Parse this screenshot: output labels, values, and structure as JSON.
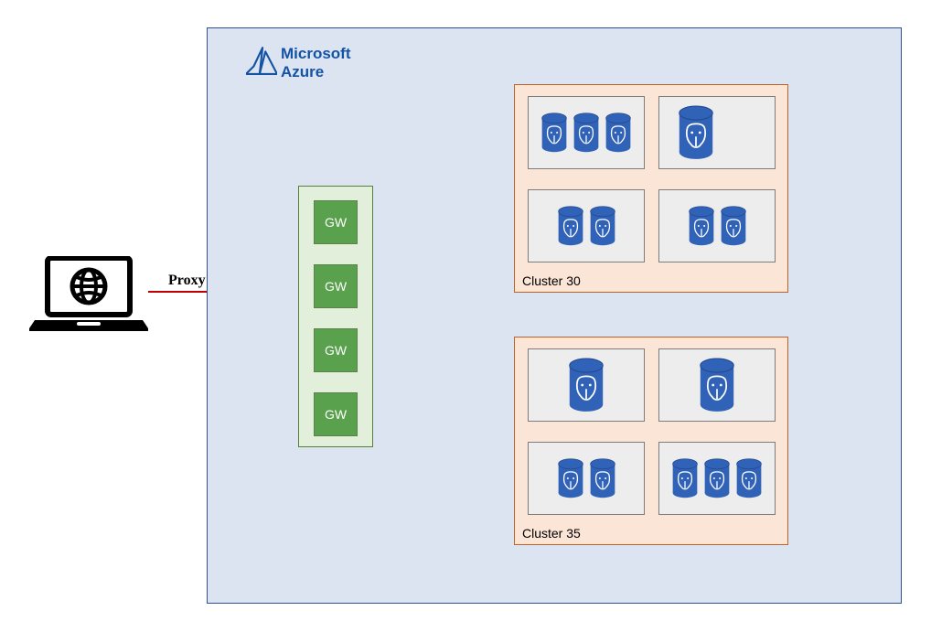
{
  "diagram": {
    "brand_top": "Microsoft",
    "brand_bottom": "Azure",
    "proxy_label": "Proxy",
    "gateways": {
      "gw1": "GW",
      "gw2": "GW",
      "gw3": "GW",
      "gw4": "GW"
    },
    "clusters": {
      "c30_label": "Cluster 30",
      "c35_label": "Cluster 35"
    },
    "colors": {
      "azure_blue": "#1453a4",
      "azure_border": "#2f528f",
      "azure_bg": "#dce4f2",
      "cluster_bg": "#fbe5d6",
      "cluster_border": "#c26124",
      "gw_bg": "#59a14d",
      "gw_container_bg": "#e2efda",
      "gw_container_border": "#548235",
      "db_blue": "#3063b8",
      "connection": "#c00000"
    }
  }
}
